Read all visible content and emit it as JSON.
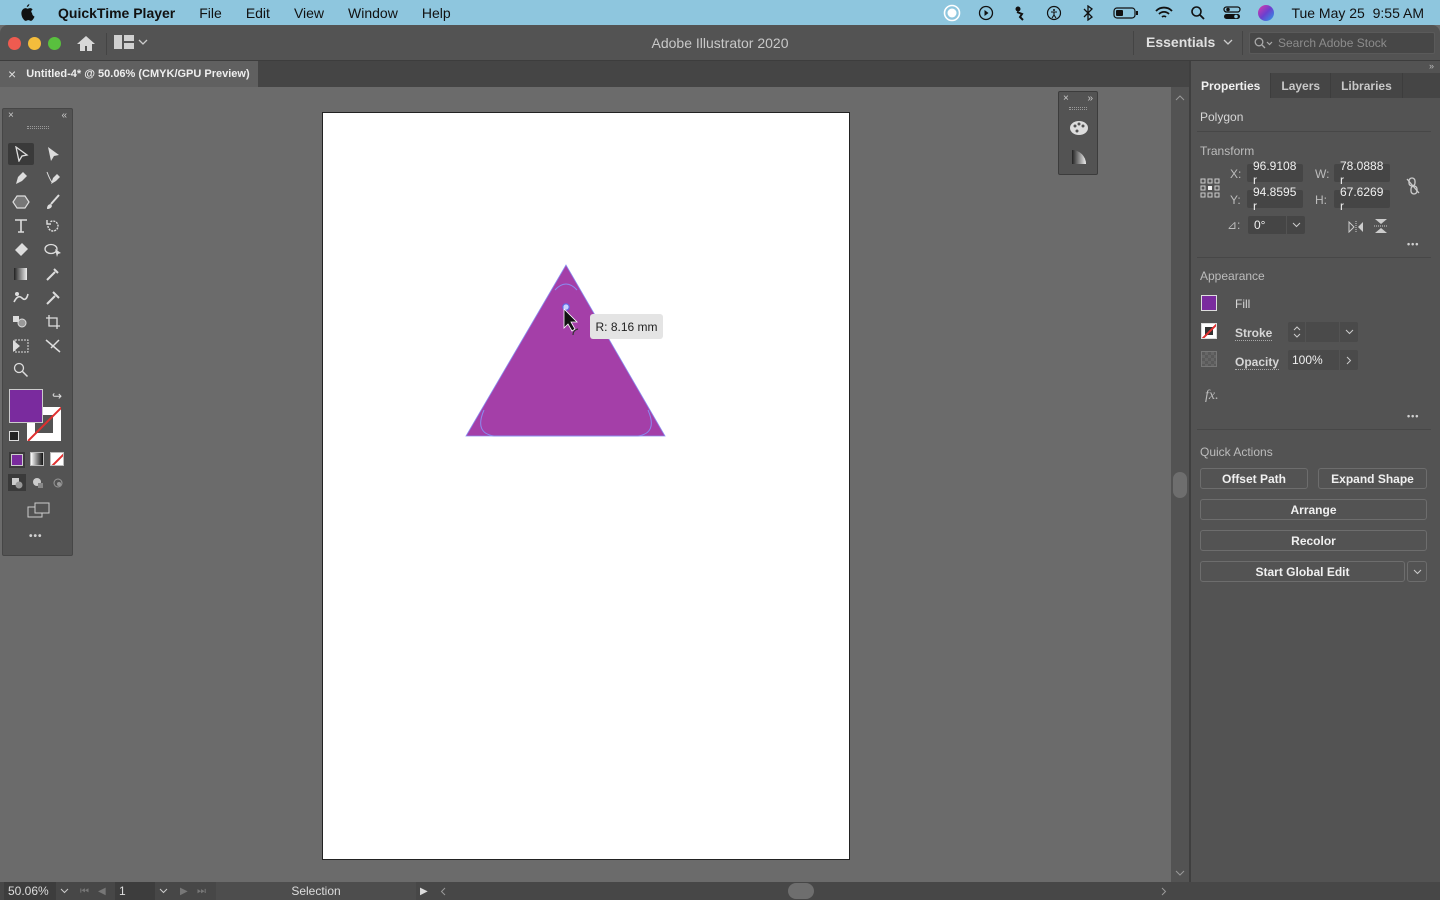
{
  "menubar": {
    "app_name": "QuickTime Player",
    "items": [
      "File",
      "Edit",
      "View",
      "Window",
      "Help"
    ],
    "clock": "Tue May 25  9:55 AM",
    "status_icons": [
      "screen-record-icon",
      "play-icon",
      "puppet-icon",
      "accessibility-icon",
      "bluetooth-icon",
      "battery-icon",
      "wifi-icon",
      "spotlight-search-icon",
      "control-center-icon",
      "siri-icon"
    ]
  },
  "window": {
    "title": "Adobe Illustrator 2020",
    "workspace": "Essentials",
    "search_placeholder": "Search Adobe Stock"
  },
  "document_tab": {
    "label": "Untitled-4* @ 50.06% (CMYK/GPU Preview)",
    "close": "×"
  },
  "canvas": {
    "shape": "triangle",
    "fill_color": "#a43fa8",
    "tooltip": "R: 8.16 mm"
  },
  "toolbar": {
    "close": "×",
    "collapse": "«",
    "more": "•••",
    "fill_color": "#7a2b9e"
  },
  "float_panel": {
    "close": "×",
    "expand": "»"
  },
  "properties": {
    "tabs": [
      "Properties",
      "Layers",
      "Libraries"
    ],
    "active_tab": 0,
    "object_type": "Polygon",
    "transform": {
      "heading": "Transform",
      "x_label": "X:",
      "x": "96.9108 r",
      "y_label": "Y:",
      "y": "94.8595 r",
      "w_label": "W:",
      "w": "78.0888 r",
      "h_label": "H:",
      "h": "67.6269 r",
      "angle_label": "⊿:",
      "angle": "0°"
    },
    "appearance": {
      "heading": "Appearance",
      "fill_label": "Fill",
      "stroke_label": "Stroke",
      "stroke_value": "",
      "opacity_label": "Opacity",
      "opacity": "100%",
      "fx": "fx."
    },
    "quick_actions": {
      "heading": "Quick Actions",
      "offset_path": "Offset Path",
      "expand_shape": "Expand Shape",
      "arrange": "Arrange",
      "recolor": "Recolor",
      "start_global_edit": "Start Global Edit"
    },
    "more": "•••"
  },
  "statusbar": {
    "zoom": "50.06%",
    "artboard": "1",
    "tool": "Selection"
  }
}
